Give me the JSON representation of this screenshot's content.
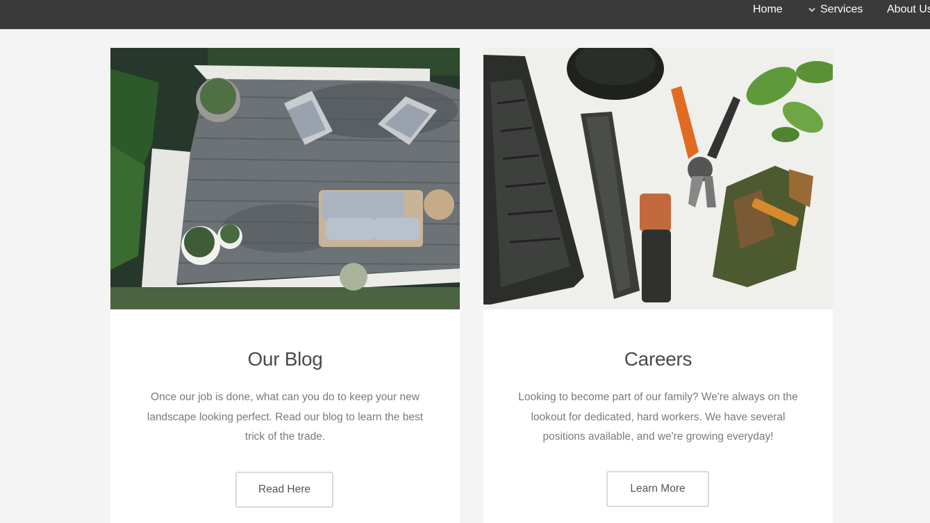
{
  "nav": {
    "items": [
      {
        "label": "Home"
      },
      {
        "label": "Services",
        "icon": "chevron-down-icon"
      },
      {
        "label": "About Us"
      }
    ]
  },
  "cards": [
    {
      "image": "patio-deck-photo",
      "title": "Our Blog",
      "text": "Once our job is done, what can you do to keep your new landscape looking perfect. Read our blog to learn the best trick of the trade.",
      "button": "Read Here"
    },
    {
      "image": "garden-tools-photo",
      "title": "Careers",
      "text": "Looking to become part of our family? We're always on the lookout for dedicated, hard workers. We have several positions available, and we're growing everyday!",
      "button": "Learn More"
    }
  ],
  "colors": {
    "topbar": "#3a3a3a",
    "page_bg": "#f4f4f4",
    "card_bg": "#ffffff",
    "title": "#4a4a4a",
    "body_text": "#7a7a7a"
  }
}
